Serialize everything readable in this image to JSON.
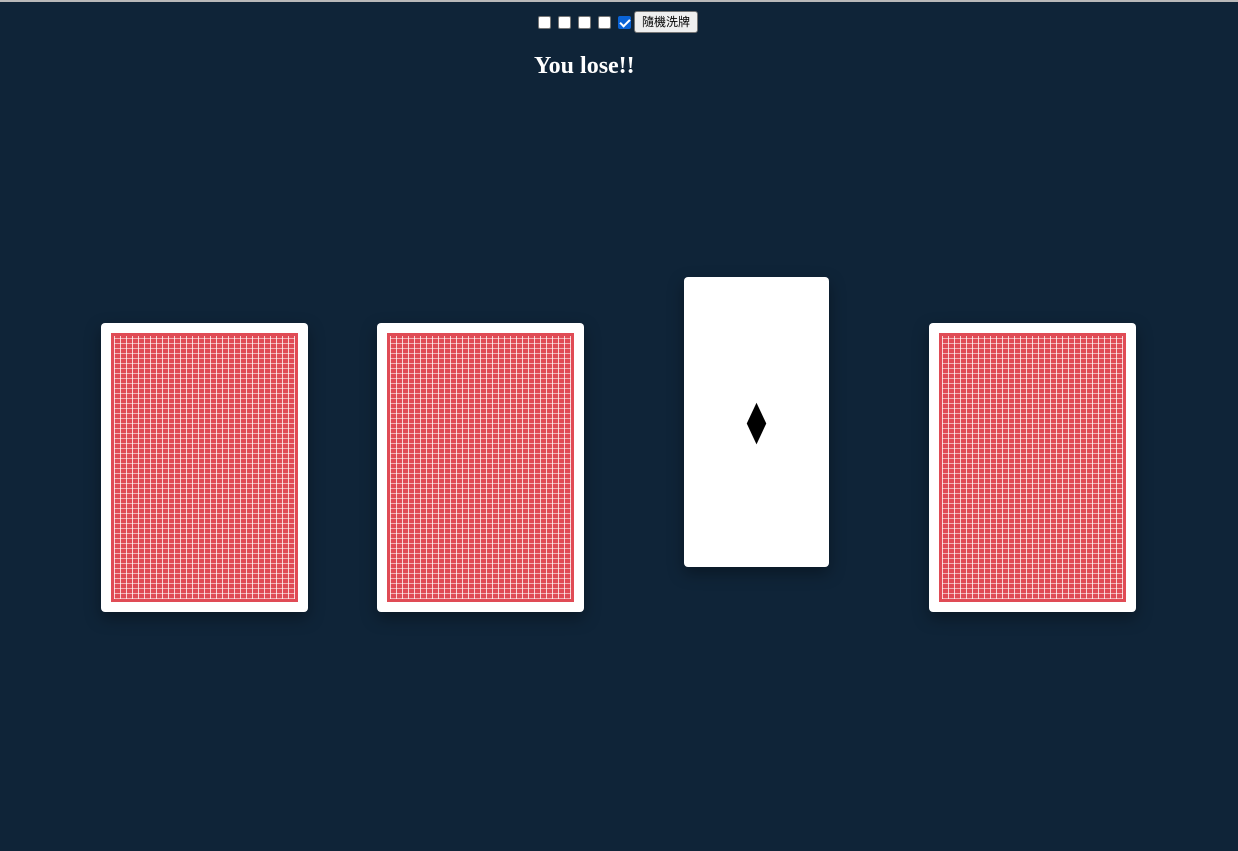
{
  "controls": {
    "checkboxes": [
      {
        "checked": false
      },
      {
        "checked": false
      },
      {
        "checked": false
      },
      {
        "checked": false
      },
      {
        "checked": true
      }
    ],
    "shuffle_label": "隨機洗牌"
  },
  "result_text": "You lose!!",
  "cards": [
    {
      "state": "face-down",
      "back_color": "#e04b55"
    },
    {
      "state": "face-down",
      "back_color": "#e04b55"
    },
    {
      "state": "face-up",
      "suit_glyph": "⧫",
      "suit_name": "diamond"
    },
    {
      "state": "face-down",
      "back_color": "#e04b55"
    }
  ],
  "colors": {
    "background": "#0f2438",
    "card_back": "#e04b55",
    "checkbox_checked": "#0a63d6"
  }
}
